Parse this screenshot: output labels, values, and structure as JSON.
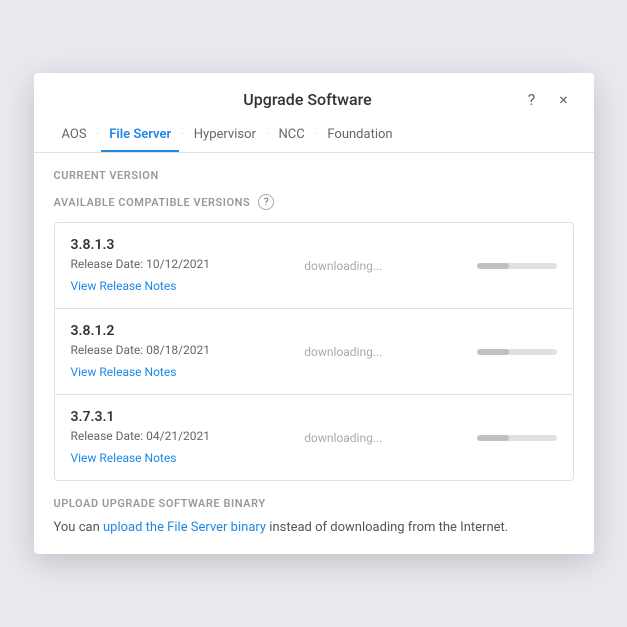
{
  "modal": {
    "title": "Upgrade Software",
    "help_icon": "?",
    "close_icon": "×"
  },
  "tabs": {
    "items": [
      {
        "label": "AOS",
        "active": false
      },
      {
        "label": "File Server",
        "active": true
      },
      {
        "label": "Hypervisor",
        "active": false
      },
      {
        "label": "NCC",
        "active": false
      },
      {
        "label": "Foundation",
        "active": false
      }
    ]
  },
  "current_version_label": "CURRENT VERSION",
  "available_versions_label": "AVAILABLE COMPATIBLE VERSIONS",
  "help_question": "?",
  "versions": [
    {
      "number": "3.8.1.3",
      "release_date": "Release Date: 10/12/2021",
      "download_status": "downloading...",
      "progress": 40,
      "view_notes": "View Release Notes"
    },
    {
      "number": "3.8.1.2",
      "release_date": "Release Date: 08/18/2021",
      "download_status": "downloading...",
      "progress": 40,
      "view_notes": "View Release Notes"
    },
    {
      "number": "3.7.3.1",
      "release_date": "Release Date: 04/21/2021",
      "download_status": "downloading...",
      "progress": 40,
      "view_notes": "View Release Notes"
    }
  ],
  "upload_section": {
    "label": "UPLOAD UPGRADE SOFTWARE BINARY",
    "text_before": "You can ",
    "link_text": "upload the File Server binary",
    "text_after": " instead of downloading from the Internet."
  }
}
